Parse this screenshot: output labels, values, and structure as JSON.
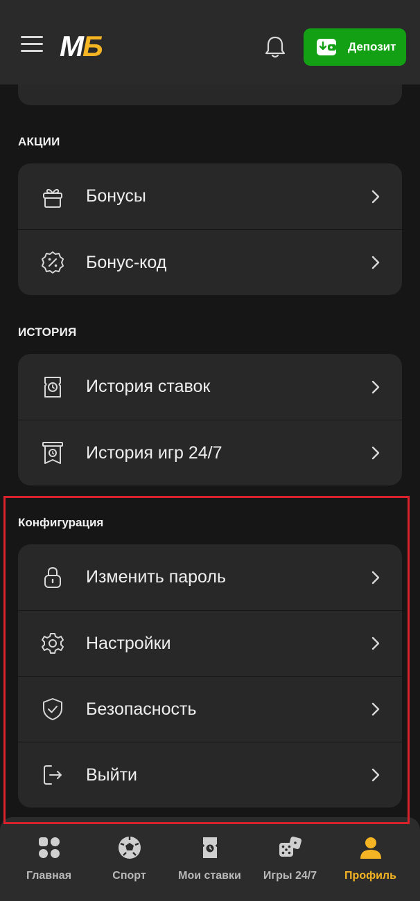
{
  "header": {
    "logo": {
      "part1": "М",
      "part2": "Б"
    },
    "deposit_label": "Депозит"
  },
  "sections": {
    "promo": {
      "title": "АКЦИИ",
      "items": [
        {
          "label": "Бонусы",
          "icon": "gift-icon"
        },
        {
          "label": "Бонус-код",
          "icon": "percent-badge-icon"
        }
      ]
    },
    "history": {
      "title": "ИСТОРИЯ",
      "items": [
        {
          "label": "История ставок",
          "icon": "bet-ticket-clock-icon"
        },
        {
          "label": "История игр 24/7",
          "icon": "game-history-icon"
        }
      ]
    },
    "config": {
      "title": "Конфигурация",
      "items": [
        {
          "label": "Изменить пароль",
          "icon": "lock-icon"
        },
        {
          "label": "Настройки",
          "icon": "gear-icon"
        },
        {
          "label": "Безопасность",
          "icon": "shield-check-icon"
        },
        {
          "label": "Выйти",
          "icon": "logout-icon"
        }
      ]
    }
  },
  "bottom_nav": {
    "items": [
      {
        "label": "Главная",
        "icon": "home-grid-icon",
        "active": false
      },
      {
        "label": "Спорт",
        "icon": "soccer-ball-icon",
        "active": false
      },
      {
        "label": "Мои ставки",
        "icon": "bet-ticket-icon",
        "active": false
      },
      {
        "label": "Игры 24/7",
        "icon": "dice-icon",
        "active": false
      },
      {
        "label": "Профиль",
        "icon": "user-icon",
        "active": true
      }
    ]
  },
  "colors": {
    "accent": "#f5b423",
    "deposit_green": "#14a014",
    "highlight_red": "#d8232f",
    "background": "#161616",
    "card": "#282828"
  }
}
